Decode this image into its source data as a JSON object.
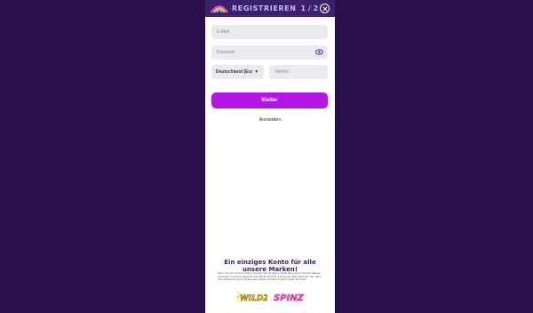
{
  "header": {
    "title": "REGISTRIEREN",
    "step": "1 / 2"
  },
  "form": {
    "email_placeholder": "E-Mail",
    "password_placeholder": "Passwort",
    "country_value": "Deutschland (Eur",
    "phone_placeholder": "Telefon",
    "submit_label": "Weiter",
    "login_link": "Anmelden"
  },
  "promo": {
    "title": "Ein einziges Konto für alle unsere Marken!",
    "text": "Wenn Sie ein Konto erstellen, können Sie mit diesem auch alle unsere anderen Marken verwenden und Ihre Rewards und Spielfortschritte mitnehmen. Bitte beachten Sie, dass eine Registrierung für Spieler aus einigen Ländern eingeschränkt sein kann.",
    "brands": [
      "WILDZ",
      "SPINZ"
    ]
  },
  "colors": {
    "background": "#2a0f4a",
    "header": "#3c2070",
    "accent": "#b215e5",
    "field": "#eceaf0"
  },
  "icons": [
    "logo-icon",
    "close-icon",
    "eye-icon",
    "chevron-down-icon"
  ]
}
